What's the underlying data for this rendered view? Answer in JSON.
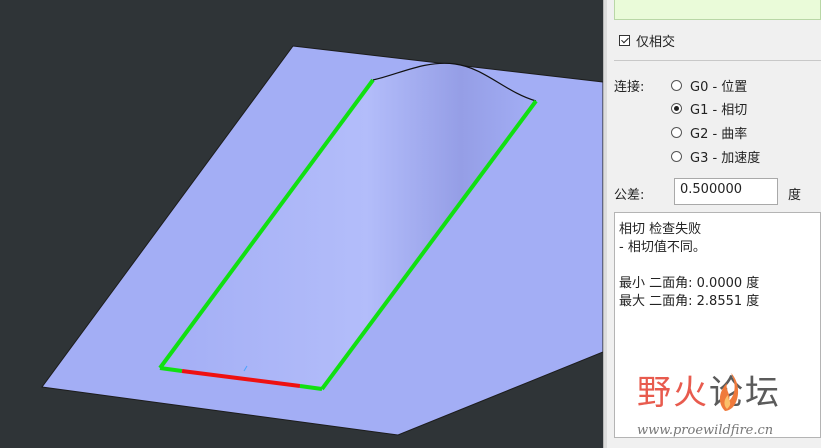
{
  "panel": {
    "intersect_only": {
      "label": "仅相交",
      "checked": true
    },
    "continuity": {
      "label": "连接:",
      "options": [
        {
          "label": "G0 - 位置",
          "selected": false
        },
        {
          "label": "G1 - 相切",
          "selected": true
        },
        {
          "label": "G2 - 曲率",
          "selected": false
        },
        {
          "label": "G3 - 加速度",
          "selected": false
        }
      ]
    },
    "tolerance": {
      "label": "公差:",
      "value": "0.500000",
      "unit": "度"
    },
    "messages": [
      "相切 检查失败",
      "- 相切值不同。",
      "",
      "最小 二面角: 0.0000 度",
      "最大 二面角: 2.8551 度"
    ]
  },
  "watermark": {
    "title_left": "野",
    "title_mid": "火",
    "title_right": "论坛",
    "url": "www.proewildfire.cn"
  },
  "colors": {
    "viewport_bg": "#2f3437",
    "surface": "#a3aef5",
    "edge_pass": "#11e011",
    "edge_fail": "#ee1111",
    "panel_bg": "#f0f0f0"
  }
}
